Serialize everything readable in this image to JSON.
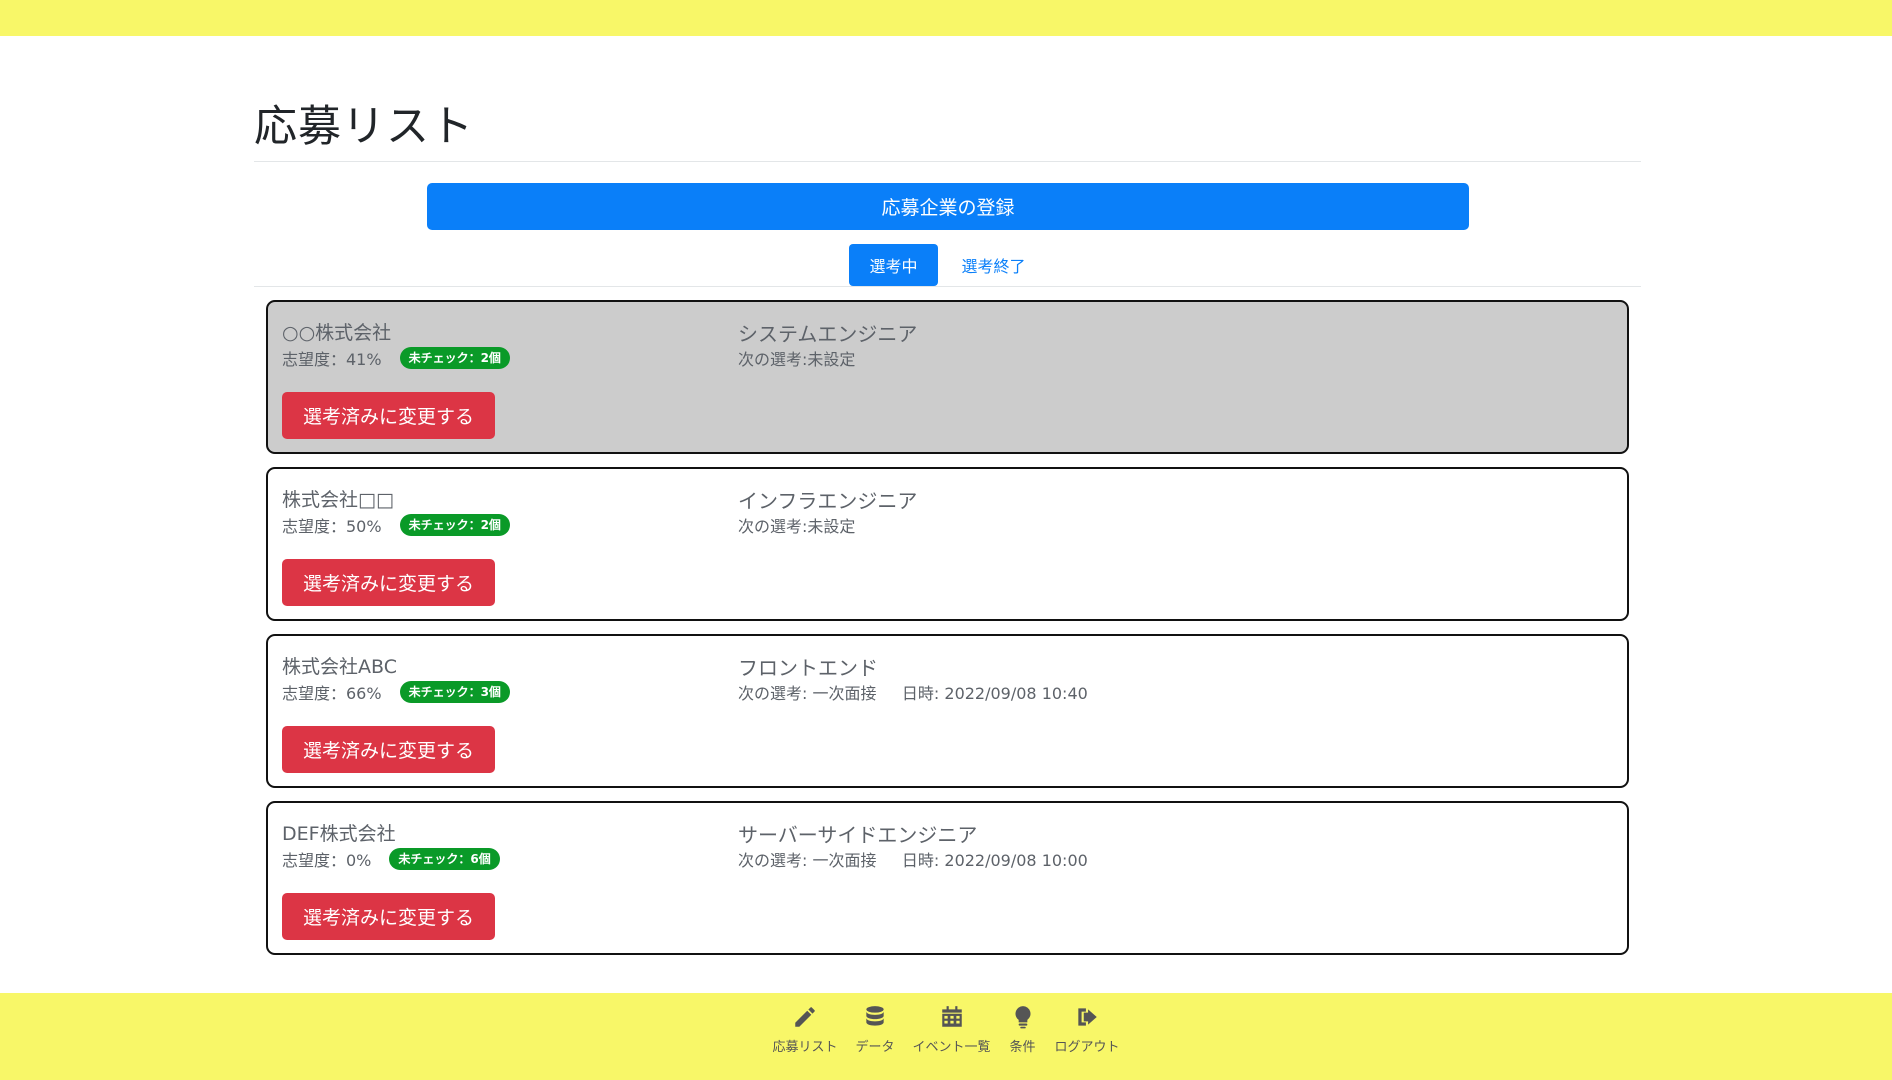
{
  "header": {
    "title": "応募リスト"
  },
  "register_button": {
    "label": "応募企業の登録"
  },
  "tabs": [
    {
      "label": "選考中",
      "active": true
    },
    {
      "label": "選考終了",
      "active": false
    }
  ],
  "applications": [
    {
      "company": "○○株式会社",
      "aspiration": "志望度：41%",
      "unchecked_badge": "未チェック：2個",
      "position": "システムエンジニア",
      "next_step": "次の選考:未設定",
      "action_label": "選考済みに変更する"
    },
    {
      "company": "株式会社□□",
      "aspiration": "志望度：50%",
      "unchecked_badge": "未チェック：2個",
      "position": "インフラエンジニア",
      "next_step": "次の選考:未設定",
      "action_label": "選考済みに変更する"
    },
    {
      "company": "株式会社ABC",
      "aspiration": "志望度：66%",
      "unchecked_badge": "未チェック：3個",
      "position": "フロントエンド",
      "next_step": "次の選考: 一次面接     日時: 2022/09/08 10:40",
      "action_label": "選考済みに変更する"
    },
    {
      "company": "DEF株式会社",
      "aspiration": "志望度：0%",
      "unchecked_badge": "未チェック：6個",
      "position": "サーバーサイドエンジニア",
      "next_step": "次の選考: 一次面接     日時: 2022/09/08 10:00",
      "action_label": "選考済みに変更する"
    }
  ],
  "bottom_nav": [
    {
      "label": "応募リスト",
      "icon": "pencil-icon"
    },
    {
      "label": "データ",
      "icon": "database-icon"
    },
    {
      "label": "イベント一覧",
      "icon": "calendar-icon"
    },
    {
      "label": "条件",
      "icon": "lightbulb-icon"
    },
    {
      "label": "ログアウト",
      "icon": "logout-icon"
    }
  ],
  "colors": {
    "accent_yellow": "#f8f768",
    "primary_blue": "#0a7ff9",
    "danger_red": "#dc3545",
    "badge_green": "#0a9a28",
    "highlight_gray": "#cccccc"
  }
}
